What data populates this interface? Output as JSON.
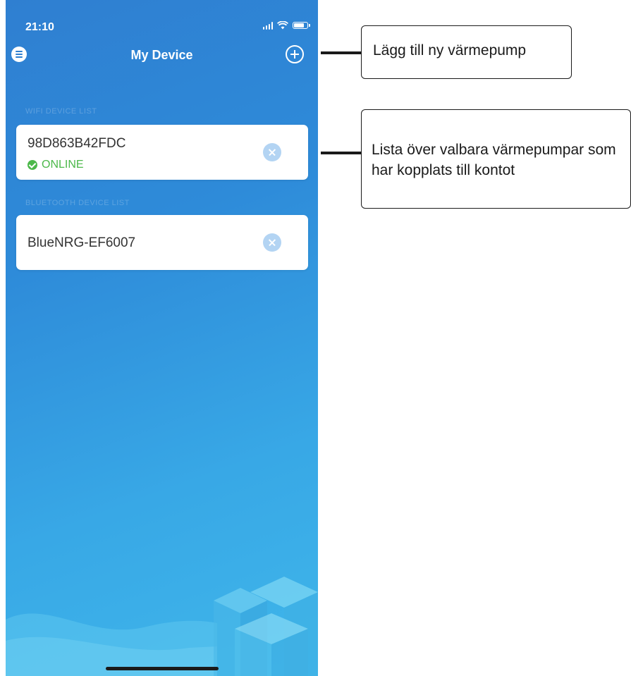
{
  "status_bar": {
    "time": "21:10"
  },
  "nav": {
    "title": "My Device"
  },
  "sections": [
    {
      "label": "WIFI DEVICE LIST"
    },
    {
      "label": "BLUETOOTH DEVICE LIST"
    }
  ],
  "devices": [
    {
      "name": "98D863B42FDC",
      "status": "ONLINE"
    },
    {
      "name": "BlueNRG-EF6007"
    }
  ],
  "annotations": {
    "add": "Lägg till ny värmepump",
    "list": "Lista över valbara värmepumpar som har kopplats till kontot"
  },
  "icons": [
    "menu-icon",
    "add-icon",
    "check-circle-icon",
    "remove-icon",
    "signal-icon",
    "wifi-icon",
    "battery-icon"
  ],
  "colors": {
    "accent": "#2e8bd9",
    "online": "#4cb84a"
  }
}
